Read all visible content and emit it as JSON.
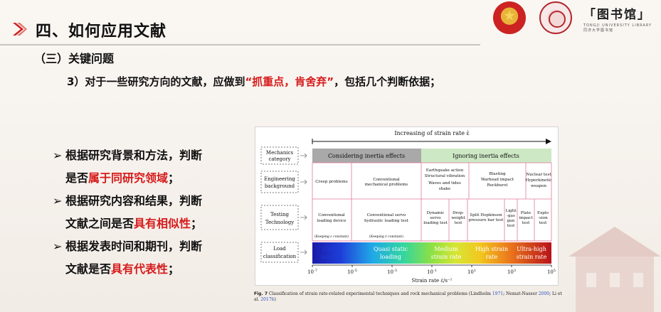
{
  "header": {
    "title": "四、如何应用文献",
    "library_logo": {
      "glyphs": "「图书馆」",
      "sub1": "TONGJI UNIVERSITY LIBRARY",
      "sub2": "同济大学图书馆"
    }
  },
  "subheading": "（三）关键问题",
  "point": {
    "prefix": "3）对于一些研究方向的文献，应做到",
    "highlight": "“抓重点，肯舍弃”",
    "suffix": "，包括几个判断依据；"
  },
  "bullets": [
    {
      "line1": "根据研究背景和方法，判断",
      "line2_prefix": "是否",
      "line2_highlight": "属于同研究领域",
      "line2_suffix": "；"
    },
    {
      "line1": "根据研究内容和结果，判断",
      "line2_prefix": "文献之间是否",
      "line2_highlight": "具有相似性",
      "line2_suffix": "；"
    },
    {
      "line1": "根据发表时间和期刊，判断",
      "line2_prefix": "文献是否",
      "line2_highlight": "具有代表性",
      "line2_suffix": "；"
    }
  ],
  "figure": {
    "top_label": "Increasing of strain rate ε̇",
    "rows": [
      {
        "label_lines": [
          "Mechanics",
          "category"
        ]
      },
      {
        "label_lines": [
          "Engineering",
          "background"
        ]
      },
      {
        "label_lines": [
          "Testing",
          "Technology"
        ]
      },
      {
        "label_lines": [
          "Load",
          "classification"
        ]
      }
    ],
    "mechanics": {
      "considering": "Considering inertia effects",
      "ignoring": "Ignoring inertia effects"
    },
    "engineering": [
      {
        "lines": [
          "Creep problems"
        ]
      },
      {
        "lines": [
          "Conventional",
          "mechanical problems"
        ]
      },
      {
        "lines": [
          "Earthquake action",
          "Structural vibration",
          "Waves and tides",
          "shake"
        ]
      },
      {
        "lines": [
          "Blasting",
          "Warhead impact",
          "Rockburst"
        ]
      },
      {
        "lines": [
          "Nuclear test",
          "Hyperkinetic",
          "weapon"
        ]
      }
    ],
    "testing": [
      {
        "lines": [
          "Conventional",
          "loading device"
        ],
        "note": "(Keeping ε constant)"
      },
      {
        "lines": [
          "Conventional servo",
          "hydraulic loading test"
        ],
        "note": "(Keeping ε̇ constant)"
      },
      {
        "lines": [
          "Dynamic",
          "servo",
          "loading test"
        ]
      },
      {
        "lines": [
          "Drop-",
          "weight",
          "test"
        ]
      },
      {
        "lines": [
          "Split Hopkinson",
          "pressure bar test"
        ]
      },
      {
        "lines": [
          "Light",
          "-gas",
          "gun",
          "test"
        ]
      },
      {
        "lines": [
          "Plate",
          "impact",
          "test"
        ]
      },
      {
        "lines": [
          "Explo",
          "-sion",
          "test"
        ]
      }
    ],
    "load": [
      {
        "lines": [
          "Creep",
          "loading"
        ]
      },
      {
        "lines": [
          "Quasi static",
          "loading"
        ]
      },
      {
        "lines": [
          "Medium",
          "strain rate"
        ]
      },
      {
        "lines": [
          "High strain",
          "rate"
        ]
      },
      {
        "lines": [
          "Ultra-high",
          "strain rate"
        ]
      }
    ],
    "axis_ticks": [
      {
        "base": "10",
        "exp": "-7"
      },
      {
        "base": "10",
        "exp": "-5"
      },
      {
        "base": "10",
        "exp": "-3"
      },
      {
        "base": "10",
        "exp": "-1"
      },
      {
        "base": "10",
        "exp": "1"
      },
      {
        "base": "10",
        "exp": "3"
      },
      {
        "base": "10",
        "exp": "5"
      }
    ],
    "axis_label": "Strain rate ε̇/s⁻¹"
  },
  "caption": {
    "label": "Fig. 7",
    "text1": "  Classification of strain rate-related experimental techniques and rock mechanical problems (Lindholm ",
    "ref1": "1971",
    "text2": "; Nemat-Nasser ",
    "ref2": "2000",
    "text3": "; Li et al. ",
    "ref3": "2017b",
    "text4": ")"
  }
}
